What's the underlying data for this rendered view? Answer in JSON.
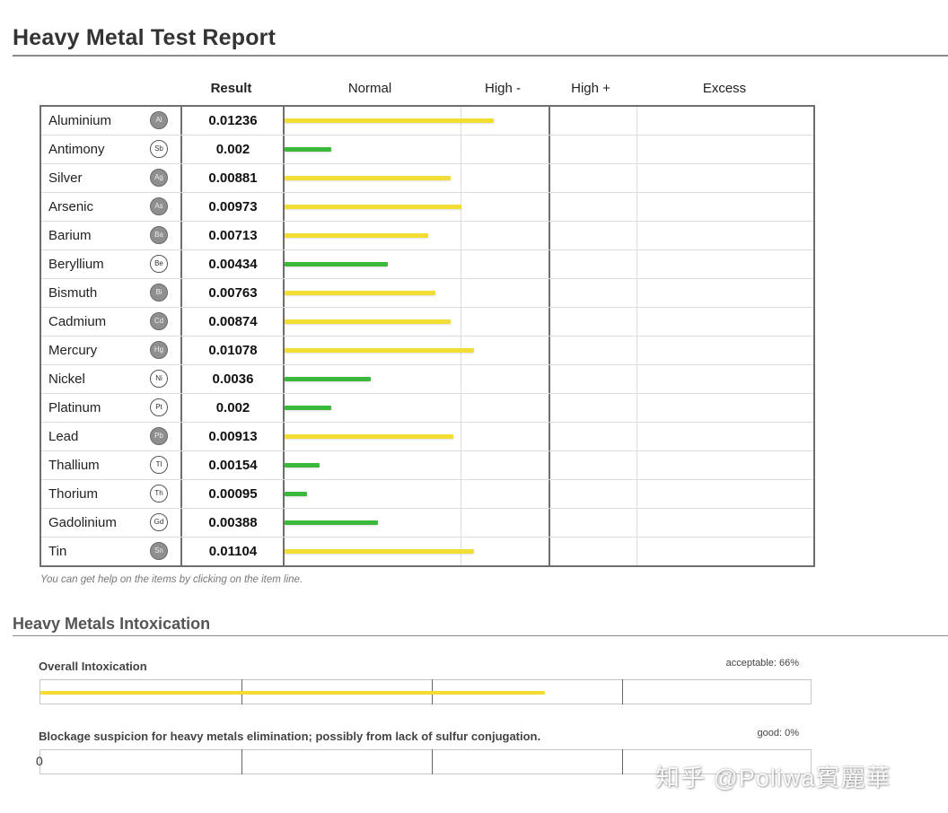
{
  "header": {
    "title": "Heavy Metal Test Report"
  },
  "table": {
    "columns": {
      "result": "Result",
      "normal": "Normal",
      "high_minus": "High -",
      "high_plus": "High +",
      "excess": "Excess"
    },
    "colors": {
      "yellow": "#f2de32",
      "green": "#3cb83c"
    },
    "rows": [
      {
        "name": "Aluminium",
        "symbol": "Al",
        "symbol_style": "filled",
        "result": "0.01236",
        "level": 0.395,
        "color": "yellow"
      },
      {
        "name": "Antimony",
        "symbol": "Sb",
        "symbol_style": "outline",
        "result": "0.002",
        "level": 0.088,
        "color": "green"
      },
      {
        "name": "Silver",
        "symbol": "Ag",
        "symbol_style": "filled",
        "result": "0.00881",
        "level": 0.314,
        "color": "yellow"
      },
      {
        "name": "Arsenic",
        "symbol": "As",
        "symbol_style": "filled",
        "result": "0.00973",
        "level": 0.335,
        "color": "yellow"
      },
      {
        "name": "Barium",
        "symbol": "Ba",
        "symbol_style": "filled",
        "result": "0.00713",
        "level": 0.272,
        "color": "yellow"
      },
      {
        "name": "Beryllium",
        "symbol": "Be",
        "symbol_style": "outline",
        "result": "0.00434",
        "level": 0.195,
        "color": "green"
      },
      {
        "name": "Bismuth",
        "symbol": "Bi",
        "symbol_style": "filled",
        "result": "0.00763",
        "level": 0.286,
        "color": "yellow"
      },
      {
        "name": "Cadmium",
        "symbol": "Cd",
        "symbol_style": "filled",
        "result": "0.00874",
        "level": 0.314,
        "color": "yellow"
      },
      {
        "name": "Mercury",
        "symbol": "Hg",
        "symbol_style": "filled",
        "result": "0.01078",
        "level": 0.359,
        "color": "yellow"
      },
      {
        "name": "Nickel",
        "symbol": "Ni",
        "symbol_style": "outline",
        "result": "0.0036",
        "level": 0.163,
        "color": "green"
      },
      {
        "name": "Platinum",
        "symbol": "Pt",
        "symbol_style": "outline",
        "result": "0.002",
        "level": 0.088,
        "color": "green"
      },
      {
        "name": "Lead",
        "symbol": "Pb",
        "symbol_style": "filled",
        "result": "0.00913",
        "level": 0.319,
        "color": "yellow"
      },
      {
        "name": "Thallium",
        "symbol": "Tl",
        "symbol_style": "outline",
        "result": "0.00154",
        "level": 0.067,
        "color": "green"
      },
      {
        "name": "Thorium",
        "symbol": "Th",
        "symbol_style": "outline",
        "result": "0.00095",
        "level": 0.042,
        "color": "green"
      },
      {
        "name": "Gadolinium",
        "symbol": "Gd",
        "symbol_style": "outline",
        "result": "0.00388",
        "level": 0.177,
        "color": "green"
      },
      {
        "name": "Tin",
        "symbol": "Sn",
        "symbol_style": "filled",
        "result": "0.01104",
        "level": 0.359,
        "color": "yellow"
      }
    ],
    "help_note": "You can get help on the items by clicking on the item line."
  },
  "intoxication": {
    "title": "Heavy Metals Intoxication",
    "overall": {
      "label": "Overall Intoxication",
      "status": "acceptable: 66%",
      "level": 0.655,
      "color": "#f2de32"
    },
    "blockage": {
      "label": "Blockage suspicion for heavy metals elimination; possibly from lack of sulfur conjugation.",
      "status": "good: 0%",
      "level": 0,
      "zero_marker": "0"
    }
  },
  "watermark": "知乎 @Poliwa賓麗華"
}
